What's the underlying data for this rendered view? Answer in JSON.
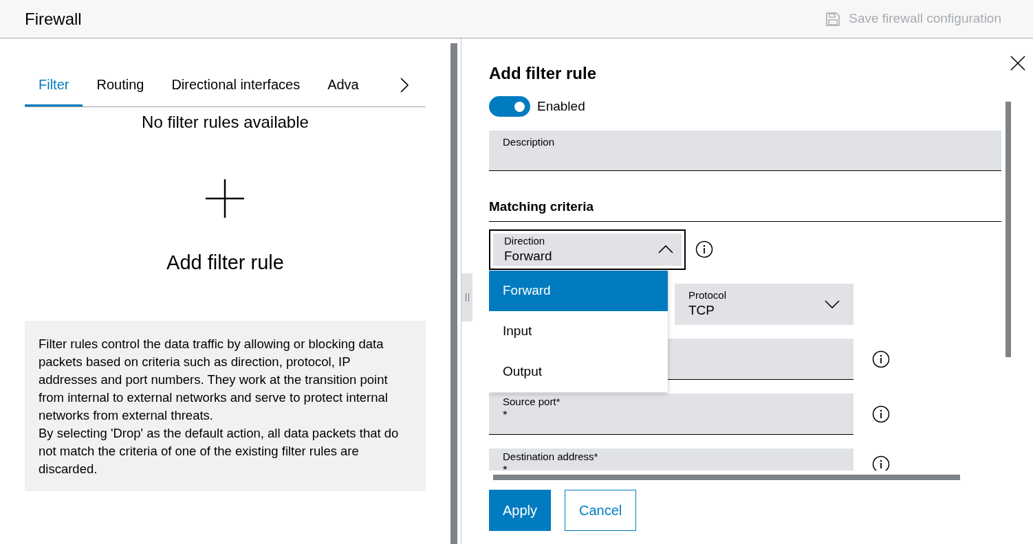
{
  "header": {
    "title": "Firewall",
    "save_button": {
      "label": "Save firewall configuration",
      "disabled": true
    }
  },
  "tabs": [
    {
      "label": "Filter",
      "selected": true
    },
    {
      "label": "Routing",
      "selected": false
    },
    {
      "label": "Directional interfaces",
      "selected": false
    },
    {
      "label": "Adva",
      "selected": false
    }
  ],
  "empty_state": {
    "message": "No filter rules available",
    "add_label": "Add filter rule"
  },
  "info_paragraphs": [
    "Filter rules control the data traffic by allowing or blocking data packets based on criteria such as direction, protocol, IP addresses and port numbers. They work at the transition point from internal to external networks and serve to protect internal networks from external threats.",
    "By selecting 'Drop' as the default action, all data packets that do not match the criteria of one of the existing filter rules are discarded."
  ],
  "panel": {
    "title": "Add filter rule",
    "enabled": {
      "label": "Enabled",
      "on": true
    },
    "description": {
      "label": "Description"
    },
    "section_title": "Matching criteria",
    "direction": {
      "label": "Direction",
      "value": "Forward",
      "expanded": true,
      "options": [
        {
          "label": "Forward",
          "selected": true
        },
        {
          "label": "Input",
          "selected": false
        },
        {
          "label": "Output",
          "selected": false
        }
      ]
    },
    "protocol": {
      "label": "Protocol",
      "value": "TCP"
    },
    "fields": [
      {
        "label": "Source port*",
        "value": "*"
      },
      {
        "label": "Destination address*",
        "value": "*"
      }
    ],
    "buttons": [
      {
        "label": "Apply",
        "kind": "primary"
      },
      {
        "label": "Cancel",
        "kind": "secondary"
      }
    ]
  }
}
